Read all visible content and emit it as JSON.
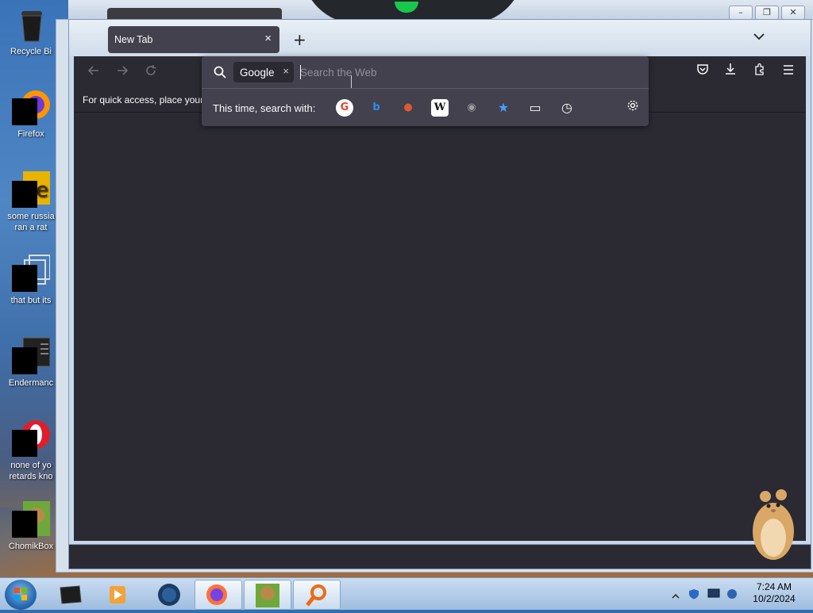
{
  "desktop": {
    "icons": [
      {
        "label": "Recycle Bi",
        "icon": "recycle-bin-icon"
      },
      {
        "label": "Firefox",
        "icon": "firefox-icon"
      },
      {
        "label": "some russia ran a rat",
        "icon": "file-icon"
      },
      {
        "label": "that but its",
        "icon": "copy-icon"
      },
      {
        "label": "Endermanc",
        "icon": "app-icon"
      },
      {
        "label": "none of yo retards kno",
        "icon": "opera-icon"
      },
      {
        "label": "ChomikBox",
        "icon": "chomikbox-icon"
      }
    ]
  },
  "browser": {
    "tab_title": "New Tab",
    "tab_close": "×",
    "new_tab": "+",
    "list_tabs": "⌄",
    "bookmarks_hint": "For quick access, place your l",
    "urlbar": {
      "engine_chip": "Google",
      "chip_remove": "×",
      "placeholder": "Search the Web",
      "switch_label": "This time, search with:",
      "engines": [
        {
          "name": "google-engine-icon",
          "glyph": "G",
          "color": "#ea4335"
        },
        {
          "name": "bing-engine-icon",
          "glyph": "b",
          "color": "#2f8fe8"
        },
        {
          "name": "duckduckgo-engine-icon",
          "glyph": "●",
          "color": "#de5833"
        },
        {
          "name": "wikipedia-engine-icon",
          "glyph": "W",
          "color": "#111111"
        },
        {
          "name": "search-engine-icon",
          "glyph": "◉",
          "color": "#9e9e9e"
        },
        {
          "name": "bookmarks-engine-icon",
          "glyph": "★",
          "color": "#45a1ff"
        },
        {
          "name": "tabs-engine-icon",
          "glyph": "▭",
          "color": "#fbfbfe"
        },
        {
          "name": "history-engine-icon",
          "glyph": "◷",
          "color": "#fbfbfe"
        }
      ]
    }
  },
  "window_controls": {
    "minimize": "–",
    "maximize": "❐",
    "close": "✕"
  },
  "taskbar": {
    "time": "7:24 AM",
    "date": "10/2/2024"
  }
}
